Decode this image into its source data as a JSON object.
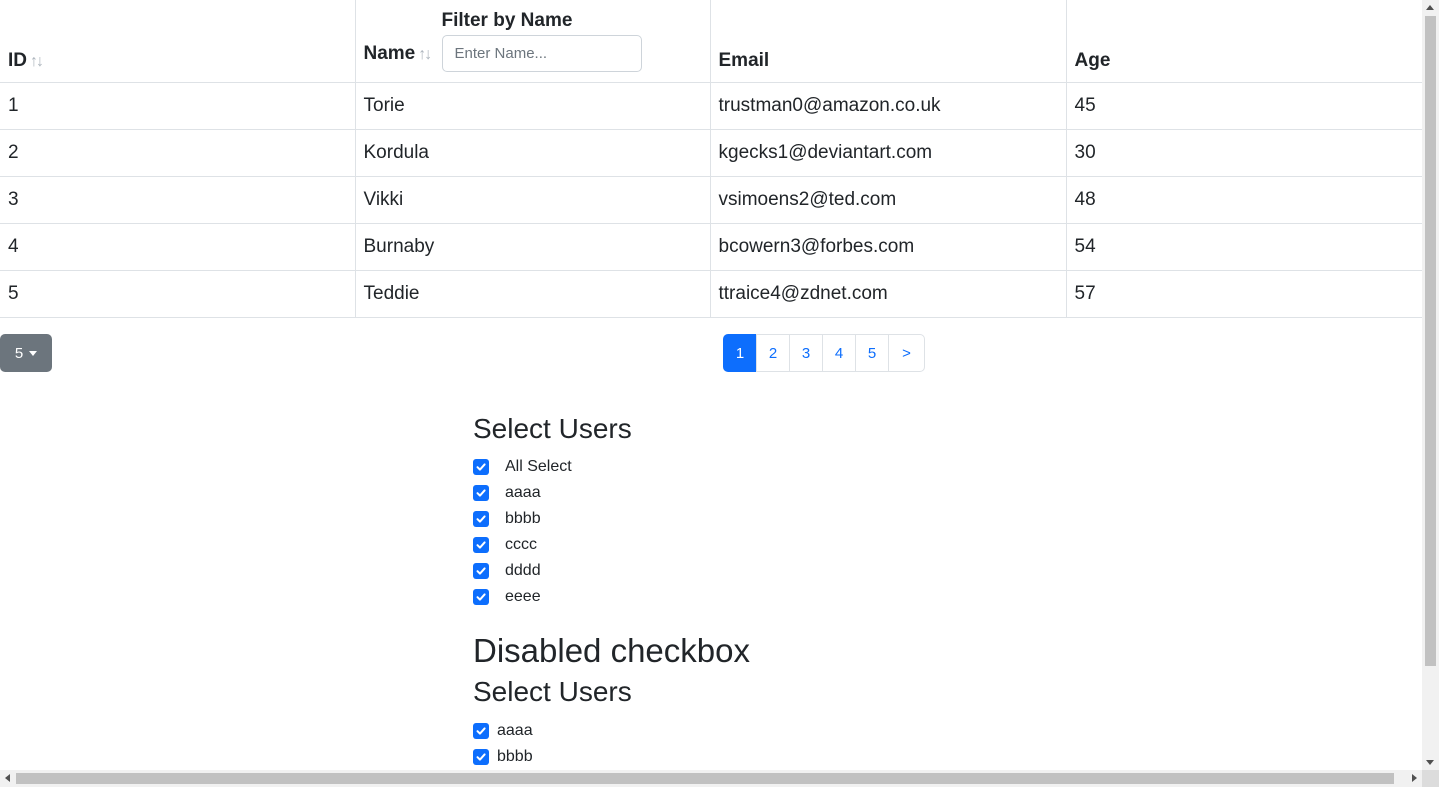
{
  "table": {
    "columns": {
      "id": "ID",
      "name": "Name",
      "email": "Email",
      "age": "Age"
    },
    "sort_icon": "↑↓",
    "filter": {
      "label": "Filter by Name",
      "placeholder": "Enter Name..."
    },
    "rows": [
      {
        "id": "1",
        "name": "Torie",
        "email": "trustman0@amazon.co.uk",
        "age": "45"
      },
      {
        "id": "2",
        "name": "Kordula",
        "email": "kgecks1@deviantart.com",
        "age": "30"
      },
      {
        "id": "3",
        "name": "Vikki",
        "email": "vsimoens2@ted.com",
        "age": "48"
      },
      {
        "id": "4",
        "name": "Burnaby",
        "email": "bcowern3@forbes.com",
        "age": "54"
      },
      {
        "id": "5",
        "name": "Teddie",
        "email": "ttraice4@zdnet.com",
        "age": "57"
      }
    ]
  },
  "page_size": {
    "value": "5"
  },
  "pagination": {
    "pages": [
      "1",
      "2",
      "3",
      "4",
      "5"
    ],
    "active": "1",
    "next": ">"
  },
  "select_users": {
    "title": "Select Users",
    "items": [
      {
        "label": "All Select",
        "checked": true
      },
      {
        "label": "aaaa",
        "checked": true
      },
      {
        "label": "bbbb",
        "checked": true
      },
      {
        "label": "cccc",
        "checked": true
      },
      {
        "label": "dddd",
        "checked": true
      },
      {
        "label": "eeee",
        "checked": true
      }
    ]
  },
  "disabled_section": {
    "heading": "Disabled checkbox",
    "title": "Select Users",
    "items": [
      {
        "label": "aaaa",
        "checked": true
      },
      {
        "label": "bbbb",
        "checked": true
      }
    ]
  },
  "colors": {
    "primary": "#0d6efd",
    "secondary": "#6c757d",
    "border": "#dee2e6"
  }
}
